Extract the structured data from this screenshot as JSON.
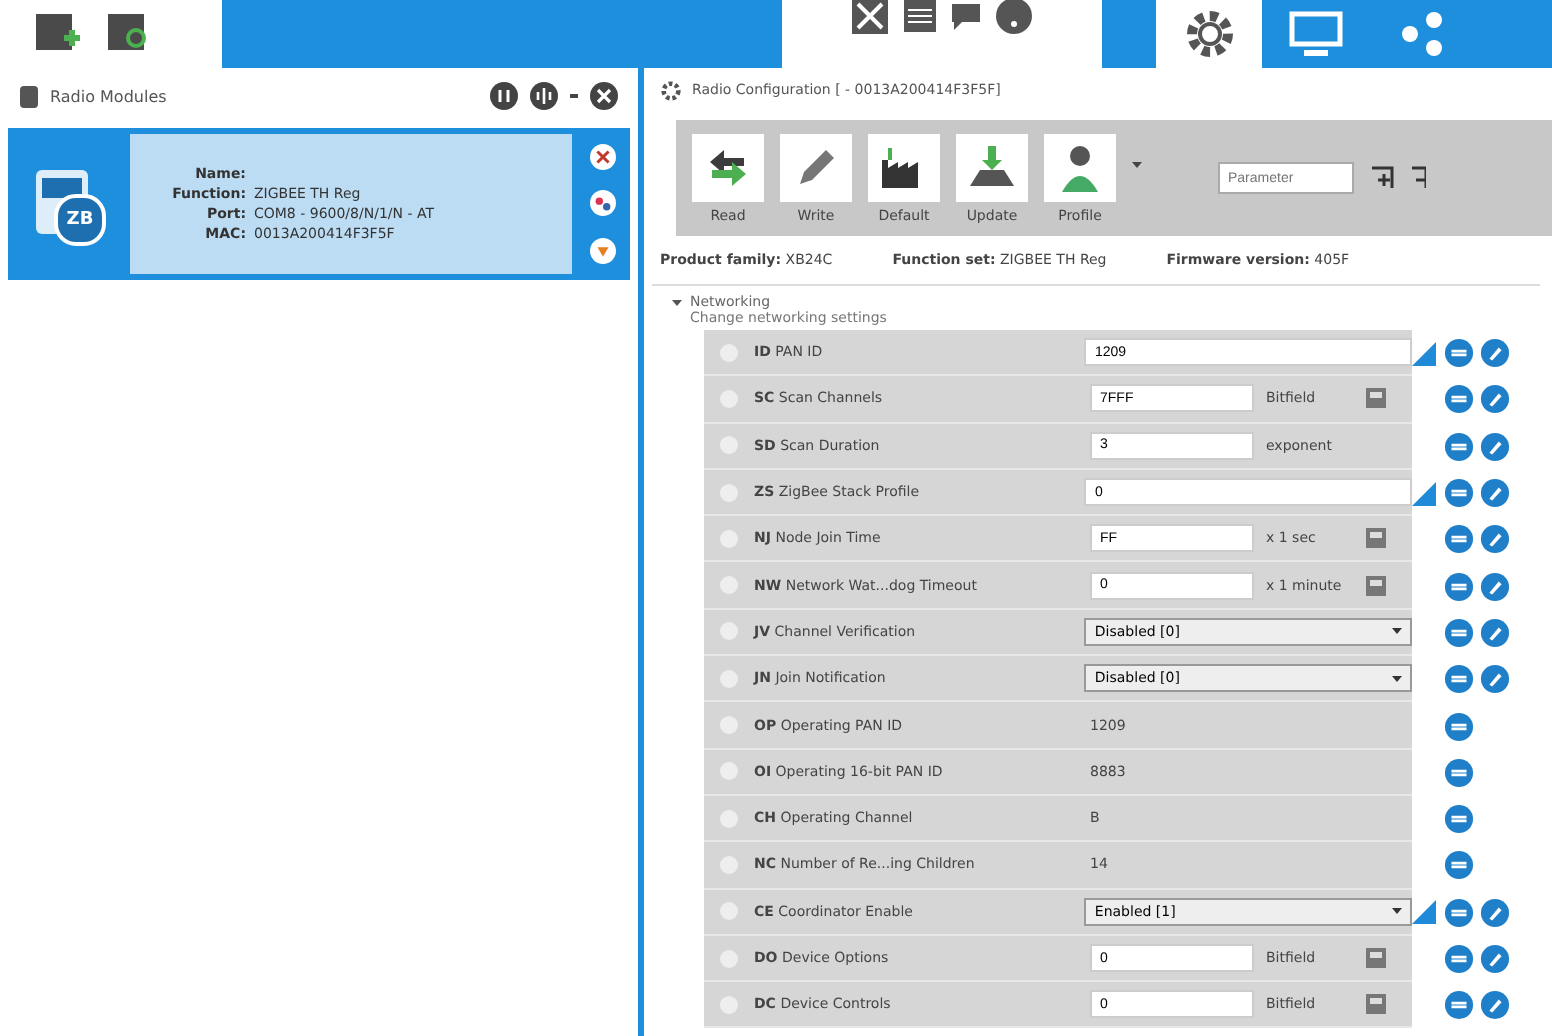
{
  "toolbar": {
    "tabs": [
      {
        "kind": "config",
        "selected": true
      },
      {
        "kind": "console",
        "selected": false
      },
      {
        "kind": "network",
        "selected": false
      }
    ]
  },
  "radio_modules": {
    "title": "Radio Modules",
    "modules": [
      {
        "selected": true,
        "badge": "ZB",
        "name_label": "Name:",
        "function_label": "Function:",
        "function": "ZIGBEE TH Reg",
        "port_label": "Port:",
        "port": "COM8 - 9600/8/N/1/N - AT",
        "mac_label": "MAC:",
        "mac": "0013A200414F3F5F"
      }
    ]
  },
  "configuration": {
    "title": "Radio Configuration [ - 0013A200414F3F5F]",
    "actions": [
      "Read",
      "Write",
      "Default",
      "Update",
      "Profile"
    ],
    "search": {
      "placeholder": "Parameter"
    },
    "product_family_label": "Product family:",
    "product_family": "XB24C",
    "function_set_label": "Function set:",
    "function_set": "ZIGBEE TH Reg",
    "firmware_label": "Firmware version:",
    "firmware": "405F",
    "section": {
      "title": "Networking",
      "subtitle": "Change networking settings",
      "expanded": true
    },
    "parameters": [
      {
        "kind": "text",
        "code": "ID",
        "name": "PAN ID",
        "value": "1209",
        "modified": true
      },
      {
        "kind": "number",
        "code": "SC",
        "name": "Scan Channels",
        "value": "7FFF",
        "unit": "Bitfield",
        "editor": true,
        "modified": false
      },
      {
        "kind": "number",
        "code": "SD",
        "name": "Scan Duration",
        "value": "3",
        "unit": "exponent",
        "editor": false,
        "modified": false
      },
      {
        "kind": "text",
        "code": "ZS",
        "name": "ZigBee Stack Profile",
        "value": "0",
        "modified": true
      },
      {
        "kind": "number",
        "code": "NJ",
        "name": "Node Join Time",
        "value": "FF",
        "unit": "x 1 sec",
        "editor": true,
        "modified": false
      },
      {
        "kind": "number",
        "code": "NW",
        "name": "Network Wat...dog Timeout",
        "value": "0",
        "unit": "x 1 minute",
        "editor": true,
        "modified": false
      },
      {
        "kind": "select",
        "code": "JV",
        "name": "Channel Verification",
        "value": "Disabled [0]",
        "modified": false
      },
      {
        "kind": "select",
        "code": "JN",
        "name": "Join Notification",
        "value": "Disabled [0]",
        "modified": false
      },
      {
        "kind": "readonly",
        "code": "OP",
        "name": "Operating PAN ID",
        "value": "1209"
      },
      {
        "kind": "readonly",
        "code": "OI",
        "name": "Operating 16-bit PAN ID",
        "value": "8883"
      },
      {
        "kind": "readonly",
        "code": "CH",
        "name": "Operating Channel",
        "value": "B"
      },
      {
        "kind": "readonly",
        "code": "NC",
        "name": "Number of Re...ing Children",
        "value": "14"
      },
      {
        "kind": "select",
        "code": "CE",
        "name": "Coordinator Enable",
        "value": "Enabled [1]",
        "modified": true
      },
      {
        "kind": "number",
        "code": "DO",
        "name": "Device Options",
        "value": "0",
        "unit": "Bitfield",
        "editor": true,
        "modified": false
      },
      {
        "kind": "number",
        "code": "DC",
        "name": "Device Controls",
        "value": "0",
        "unit": "Bitfield",
        "editor": true,
        "modified": false
      }
    ]
  }
}
